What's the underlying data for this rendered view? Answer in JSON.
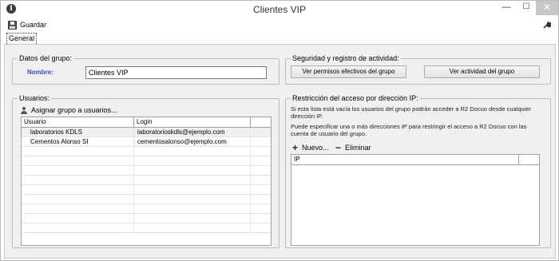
{
  "window": {
    "title": "Clientes VIP",
    "info_icon": "i",
    "min_glyph": "—",
    "max_glyph": "☐",
    "close_glyph": "✕"
  },
  "toolbar": {
    "save_label": "Guardar",
    "settings_icon": "wrench-icon"
  },
  "tabs": [
    {
      "label": "General",
      "selected": true
    }
  ],
  "datos_grupo": {
    "legend": "Datos del grupo:",
    "nombre_label": "Nombre:",
    "nombre_value": "Clientes VIP"
  },
  "seguridad": {
    "legend": "Seguridad y registro de actividad:",
    "permisos_button": "Ver permisos efectivos del grupo",
    "actividad_button": "Ver actividad del grupo"
  },
  "usuarios": {
    "legend": "Usuarios:",
    "assign_label": "Asignar grupo a usuarios...",
    "columns": [
      "Usuario",
      "Login"
    ],
    "rows": [
      {
        "usuario": "laboratorios KDLS",
        "login": "laboratorioskdls@ejemplo.com"
      },
      {
        "usuario": "Cementos Alonso SI",
        "login": "cementosalonso@ejemplo.com"
      }
    ]
  },
  "restriccion": {
    "legend": "Restricción del acceso por dirección IP:",
    "help_1": "Si esta lista está vacía los usuarios del grupo podrán acceder a R2 Docuo desde cualquier dirección IP.",
    "help_2": "Puede especificar una o más direcciones IP para restringir el acceso a R2 Docuo con las cuenta de usuario del grupo.",
    "new_label": "Nuevo...",
    "delete_label": "Eliminar",
    "columns": [
      "IP"
    ],
    "rows": []
  }
}
